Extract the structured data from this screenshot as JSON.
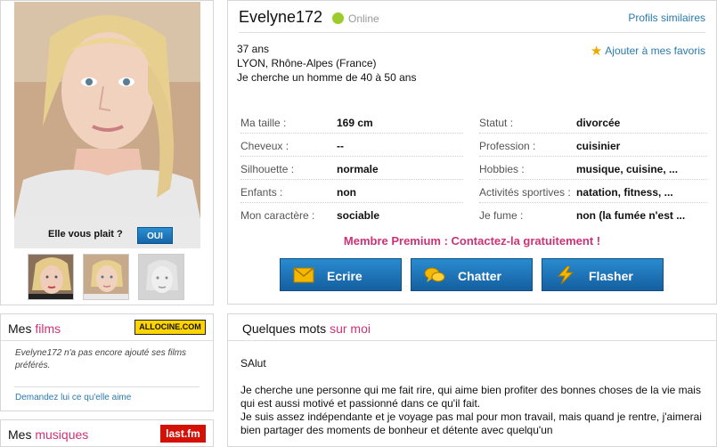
{
  "profile": {
    "name": "Evelyne172",
    "status": "Online",
    "similar_link": "Profils similaires",
    "age": "37 ans",
    "location": "LYON, Rhône-Alpes (France)",
    "seeking": "Je cherche un homme de 40 à 50 ans",
    "favorite_link": "Ajouter à mes favoris",
    "online_color": "#9ccc2c"
  },
  "photo": {
    "like_question": "Elle vous plait ?",
    "yes_label": "OUI"
  },
  "attributes_left": [
    {
      "label": "Ma taille :",
      "value": "169 cm"
    },
    {
      "label": "Cheveux :",
      "value": "--"
    },
    {
      "label": "Silhouette :",
      "value": "normale"
    },
    {
      "label": "Enfants :",
      "value": "non"
    },
    {
      "label": "Mon caractère :",
      "value": "sociable"
    }
  ],
  "attributes_right": [
    {
      "label": "Statut :",
      "value": "divorcée"
    },
    {
      "label": "Profession :",
      "value": "cuisinier"
    },
    {
      "label": "Hobbies :",
      "value": "musique, cuisine, ..."
    },
    {
      "label": "Activités sportives :",
      "value": "natation, fitness, ..."
    },
    {
      "label": "Je fume :",
      "value": "non (la fumée n'est ..."
    }
  ],
  "premium_text": "Membre Premium : Contactez-la gratuitement !",
  "actions": {
    "write": "Ecrire",
    "chat": "Chatter",
    "flash": "Flasher"
  },
  "films": {
    "title_prefix": "Mes ",
    "title_accent": "films",
    "brand": "ALLOCINE.COM",
    "empty_text": "Evelyne172 n'a pas encore ajouté ses films préférés.",
    "ask_link": "Demandez lui ce qu'elle aime"
  },
  "music": {
    "title_prefix": "Mes ",
    "title_accent": "musiques",
    "brand": "last.fm"
  },
  "about": {
    "title_prefix": "Quelques mots ",
    "title_accent": "sur moi",
    "greeting": "SAlut",
    "line1": "Je cherche une personne qui me fait rire, qui aime bien profiter des bonnes choses de la vie mais qui est aussi motivé et passionné dans ce qu'il fait.",
    "line2": "Je suis assez indépendante et je voyage pas mal pour mon travail, mais quand je rentre, j'aimerai bien partager des moments de bonheur et détente avec quelqu'un"
  },
  "colors": {
    "accent": "#cc3377",
    "link": "#2a7aad",
    "button": "#1a72b8"
  }
}
